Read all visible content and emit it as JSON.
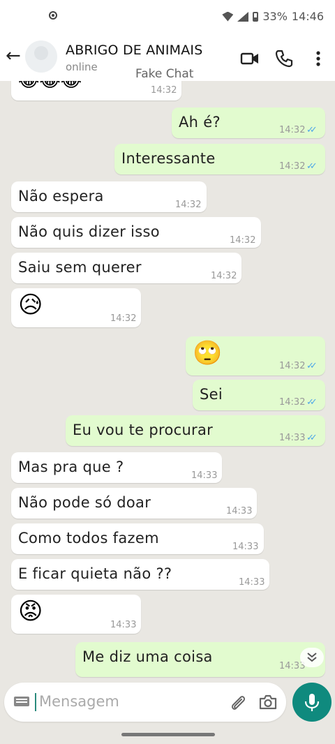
{
  "status_bar": {
    "battery": "33%",
    "time": "14:46"
  },
  "header": {
    "contact_name": "ABRIGO DE ANIMAIS",
    "status": "online",
    "overlay_text": "Fake Chat"
  },
  "messages": [
    {
      "dir": "in",
      "text": "😂😂😂",
      "emoji": true,
      "time": "14:32"
    },
    {
      "dir": "out",
      "text": "Ah é?",
      "time": "14:32",
      "ticks": "✓✓"
    },
    {
      "dir": "out",
      "text": "Interessante",
      "time": "14:32",
      "ticks": "✓✓"
    },
    {
      "dir": "in",
      "text": "Não espera",
      "time": "14:32"
    },
    {
      "dir": "in",
      "text": "Não quis dizer isso",
      "time": "14:32"
    },
    {
      "dir": "in",
      "text": "Saiu sem querer",
      "time": "14:32"
    },
    {
      "dir": "in",
      "text": "😥",
      "emoji": true,
      "time": "14:32"
    },
    {
      "dir": "out",
      "text": "🙄",
      "emoji": true,
      "time": "14:32",
      "ticks": "✓✓"
    },
    {
      "dir": "out",
      "text": "Sei",
      "time": "14:32",
      "ticks": "✓✓"
    },
    {
      "dir": "out",
      "text": "Eu vou te procurar",
      "time": "14:33",
      "ticks": "✓✓"
    },
    {
      "dir": "in",
      "text": "Mas pra que ?",
      "time": "14:33"
    },
    {
      "dir": "in",
      "text": "Não pode só doar",
      "time": "14:33"
    },
    {
      "dir": "in",
      "text": "Como todos fazem",
      "time": "14:33"
    },
    {
      "dir": "in",
      "text": "E ficar quieta não ??",
      "time": "14:33"
    },
    {
      "dir": "in",
      "text": "😡",
      "emoji": true,
      "time": "14:33"
    },
    {
      "dir": "out",
      "text": "Me diz uma coisa",
      "time": "14:33"
    }
  ],
  "input": {
    "placeholder": "Mensagem"
  },
  "colors": {
    "incoming": "#ffffff",
    "outgoing": "#e2fbcf",
    "accent": "#0f8a7e",
    "read_ticks": "#4fa8e8"
  }
}
